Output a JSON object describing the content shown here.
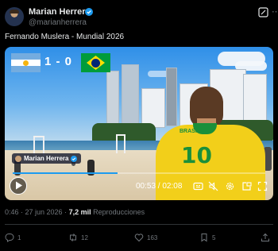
{
  "author": {
    "name": "Marian Herrera",
    "handle": "@marianherrera",
    "verified_color": "#1d9bf0"
  },
  "post": {
    "text": "Fernando Muslera - Mundial 2026"
  },
  "video": {
    "score": "1 - 0",
    "flags": [
      "argentina-flag",
      "brazil-flag"
    ],
    "watermark": "Marian Herrera",
    "jersey_number": "10",
    "jersey_text": "BRASIL",
    "time": "00:53 / 02:08",
    "progress": 0.415,
    "controls": [
      "play-icon",
      "cc-icon",
      "mute-icon",
      "settings-icon",
      "pip-icon",
      "fullscreen-icon"
    ]
  },
  "meta": {
    "time": "0:46 · 27 jun 2026 · ",
    "views": "7,2 mil",
    "views_label": " Reproducciones"
  },
  "actions": {
    "replies": "1",
    "reposts": "12",
    "likes": "163",
    "bookmarks": "5"
  },
  "colors": {
    "background": "#000000",
    "accent": "#1d9bf0",
    "muted": "#71767b"
  }
}
